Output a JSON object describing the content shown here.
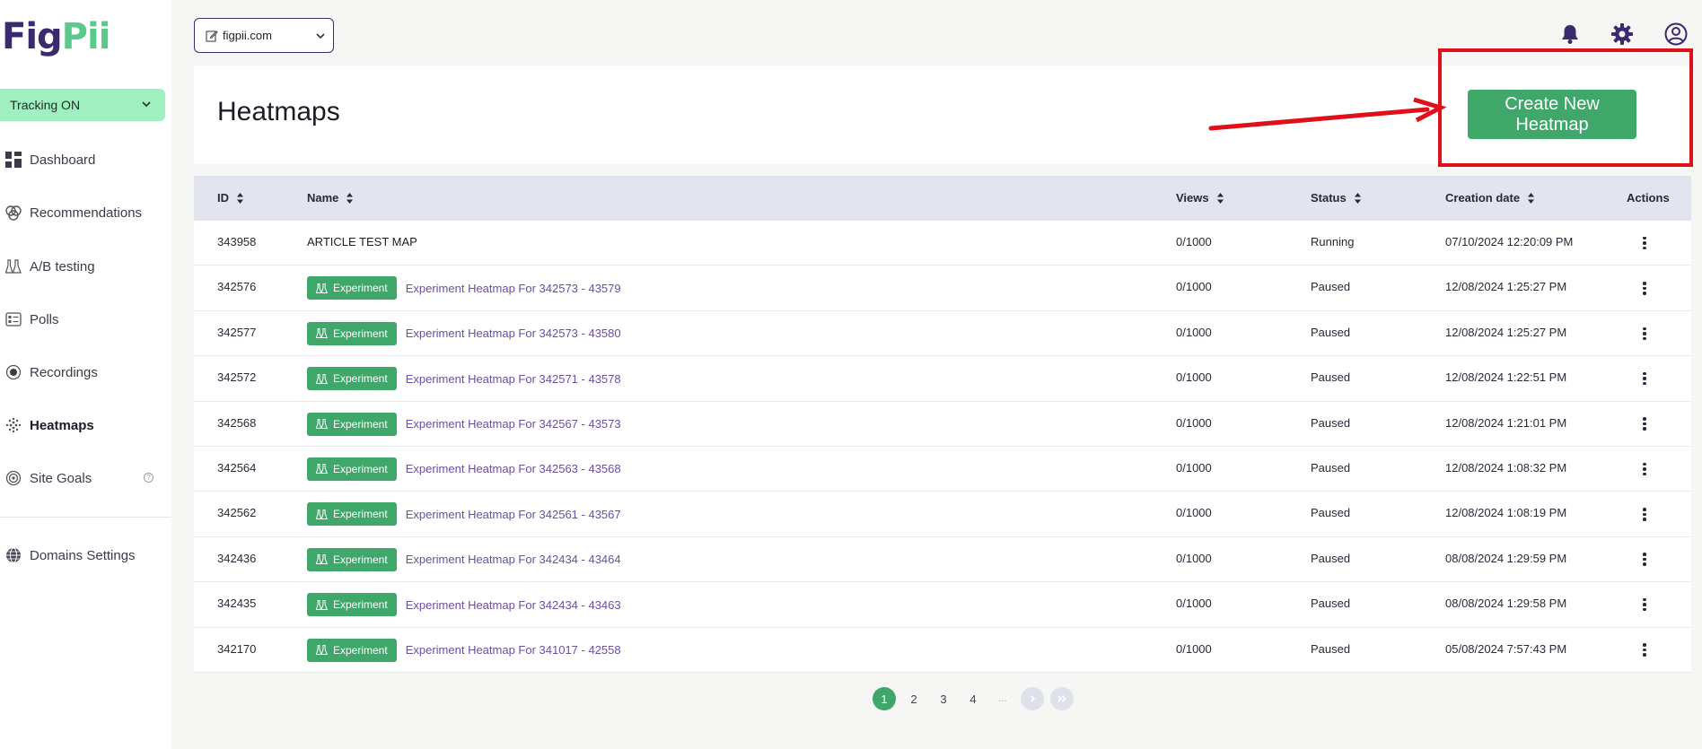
{
  "logo": {
    "part1": "Fig",
    "part2": "Pii"
  },
  "tracking": {
    "label": "Tracking ON"
  },
  "sidebar": {
    "items": [
      {
        "label": "Dashboard",
        "icon": "dashboard-icon"
      },
      {
        "label": "Recommendations",
        "icon": "brain-icon"
      },
      {
        "label": "A/B testing",
        "icon": "flask-icon"
      },
      {
        "label": "Polls",
        "icon": "poll-icon"
      },
      {
        "label": "Recordings",
        "icon": "record-icon"
      },
      {
        "label": "Heatmaps",
        "icon": "heatmap-icon"
      },
      {
        "label": "Site Goals",
        "icon": "target-icon"
      },
      {
        "label": "Domains Settings",
        "icon": "globe-icon"
      }
    ]
  },
  "domain": {
    "value": "figpii.com"
  },
  "header": {
    "title": "Heatmaps",
    "create_label": "Create New Heatmap"
  },
  "table": {
    "columns": [
      "ID",
      "Name",
      "Views",
      "Status",
      "Creation date",
      "Actions"
    ],
    "badge_label": "Experiment",
    "rows": [
      {
        "id": "343958",
        "name": "ARTICLE TEST MAP",
        "experiment": false,
        "views": "0/1000",
        "status": "Running",
        "date": "07/10/2024 12:20:09 PM"
      },
      {
        "id": "342576",
        "name": "Experiment Heatmap For 342573 - 43579",
        "experiment": true,
        "views": "0/1000",
        "status": "Paused",
        "date": "12/08/2024 1:25:27 PM"
      },
      {
        "id": "342577",
        "name": "Experiment Heatmap For 342573 - 43580",
        "experiment": true,
        "views": "0/1000",
        "status": "Paused",
        "date": "12/08/2024 1:25:27 PM"
      },
      {
        "id": "342572",
        "name": "Experiment Heatmap For 342571 - 43578",
        "experiment": true,
        "views": "0/1000",
        "status": "Paused",
        "date": "12/08/2024 1:22:51 PM"
      },
      {
        "id": "342568",
        "name": "Experiment Heatmap For 342567 - 43573",
        "experiment": true,
        "views": "0/1000",
        "status": "Paused",
        "date": "12/08/2024 1:21:01 PM"
      },
      {
        "id": "342564",
        "name": "Experiment Heatmap For 342563 - 43568",
        "experiment": true,
        "views": "0/1000",
        "status": "Paused",
        "date": "12/08/2024 1:08:32 PM"
      },
      {
        "id": "342562",
        "name": "Experiment Heatmap For 342561 - 43567",
        "experiment": true,
        "views": "0/1000",
        "status": "Paused",
        "date": "12/08/2024 1:08:19 PM"
      },
      {
        "id": "342436",
        "name": "Experiment Heatmap For 342434 - 43464",
        "experiment": true,
        "views": "0/1000",
        "status": "Paused",
        "date": "08/08/2024 1:29:59 PM"
      },
      {
        "id": "342435",
        "name": "Experiment Heatmap For 342434 - 43463",
        "experiment": true,
        "views": "0/1000",
        "status": "Paused",
        "date": "08/08/2024 1:29:58 PM"
      },
      {
        "id": "342170",
        "name": "Experiment Heatmap For 341017 - 42558",
        "experiment": true,
        "views": "0/1000",
        "status": "Paused",
        "date": "05/08/2024 7:57:43 PM"
      }
    ]
  },
  "pagination": {
    "pages": [
      "1",
      "2",
      "3",
      "4"
    ],
    "ellipsis": "...",
    "current": "1"
  },
  "colors": {
    "brand_purple": "#3b2a6d",
    "brand_green": "#3fa76a",
    "highlight_red": "#e0101a"
  }
}
